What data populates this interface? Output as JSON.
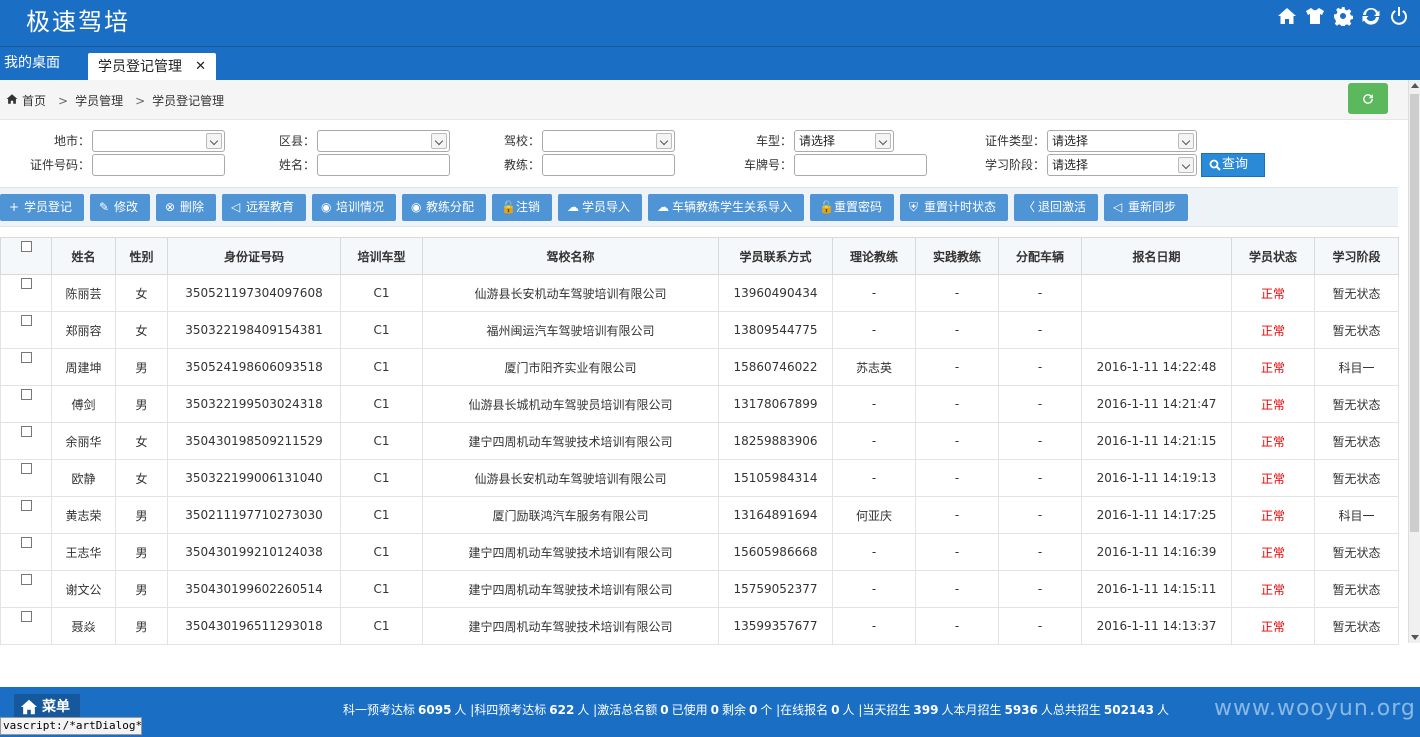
{
  "header": {
    "brand": "极速驾培",
    "icons": [
      "home-icon",
      "shirt-icon",
      "gear-icon",
      "refresh-icon",
      "power-icon"
    ]
  },
  "tabs": {
    "desk": "我的桌面",
    "active": "学员登记管理",
    "close": "✕"
  },
  "breadcrumb": {
    "home": "首页",
    "level1": "学员管理",
    "level2": "学员登记管理",
    "sep": ">"
  },
  "filters": {
    "city_label": "地市：",
    "district_label": "区县：",
    "school_label": "驾校：",
    "car_type_label": "车型：",
    "car_type_value": "请选择",
    "id_type_label": "证件类型：",
    "id_type_value": "请选择",
    "id_no_label": "证件号码：",
    "name_label": "姓名：",
    "coach_label": "教练：",
    "plate_label": "车牌号：",
    "stage_label": "学习阶段：",
    "stage_value": "请选择",
    "search_label": "查询"
  },
  "toolbar": [
    {
      "icon": "+",
      "label": "学员登记"
    },
    {
      "icon": "✎",
      "label": "修改"
    },
    {
      "icon": "⊗",
      "label": "删除"
    },
    {
      "icon": "◁",
      "label": "远程教育"
    },
    {
      "icon": "◉",
      "label": "培训情况"
    },
    {
      "icon": "◉",
      "label": "教练分配"
    },
    {
      "icon": "🔓",
      "label": "注销"
    },
    {
      "icon": "☁",
      "label": "学员导入"
    },
    {
      "icon": "☁",
      "label": "车辆教练学生关系导入"
    },
    {
      "icon": "🔓",
      "label": "重置密码"
    },
    {
      "icon": "⛨",
      "label": "重置计时状态"
    },
    {
      "icon": "〈",
      "label": "退回激活"
    },
    {
      "icon": "◁",
      "label": "重新同步"
    }
  ],
  "table": {
    "columns": [
      "姓名",
      "性别",
      "身份证号码",
      "培训车型",
      "驾校名称",
      "学员联系方式",
      "理论教练",
      "实践教练",
      "分配车辆",
      "报名日期",
      "学员状态",
      "学习阶段"
    ],
    "rows": [
      [
        "陈丽芸",
        "女",
        "350521197304097608",
        "C1",
        "仙游县长安机动车驾驶培训有限公司",
        "13960490434",
        "-",
        "-",
        "-",
        "",
        "正常",
        "暂无状态"
      ],
      [
        "郑丽容",
        "女",
        "350322198409154381",
        "C1",
        "福州闽运汽车驾驶培训有限公司",
        "13809544775",
        "-",
        "-",
        "-",
        "",
        "正常",
        "暂无状态"
      ],
      [
        "周建坤",
        "男",
        "350524198606093518",
        "C1",
        "厦门市阳齐实业有限公司",
        "15860746022",
        "苏志英",
        "-",
        "-",
        "2016-1-11 14:22:48",
        "正常",
        "科目一"
      ],
      [
        "傅剑",
        "男",
        "350322199503024318",
        "C1",
        "仙游县长城机动车驾驶员培训有限公司",
        "13178067899",
        "-",
        "-",
        "-",
        "2016-1-11 14:21:47",
        "正常",
        "暂无状态"
      ],
      [
        "余丽华",
        "女",
        "350430198509211529",
        "C1",
        "建宁四周机动车驾驶技术培训有限公司",
        "18259883906",
        "-",
        "-",
        "-",
        "2016-1-11 14:21:15",
        "正常",
        "暂无状态"
      ],
      [
        "欧静",
        "女",
        "350322199006131040",
        "C1",
        "仙游县长安机动车驾驶培训有限公司",
        "15105984314",
        "-",
        "-",
        "-",
        "2016-1-11 14:19:13",
        "正常",
        "暂无状态"
      ],
      [
        "黄志荣",
        "男",
        "350211197710273030",
        "C1",
        "厦门励联鸿汽车服务有限公司",
        "13164891694",
        "何亚庆",
        "-",
        "-",
        "2016-1-11 14:17:25",
        "正常",
        "科目一"
      ],
      [
        "王志华",
        "男",
        "350430199210124038",
        "C1",
        "建宁四周机动车驾驶技术培训有限公司",
        "15605986668",
        "-",
        "-",
        "-",
        "2016-1-11 14:16:39",
        "正常",
        "暂无状态"
      ],
      [
        "谢文公",
        "男",
        "350430199602260514",
        "C1",
        "建宁四周机动车驾驶技术培训有限公司",
        "15759052377",
        "-",
        "-",
        "-",
        "2016-1-11 14:15:11",
        "正常",
        "暂无状态"
      ],
      [
        "聂焱",
        "男",
        "350430196511293018",
        "C1",
        "建宁四周机动车驾驶技术培训有限公司",
        "13599357677",
        "-",
        "-",
        "-",
        "2016-1-11 14:13:37",
        "正常",
        "暂无状态"
      ]
    ]
  },
  "footer": {
    "menu": "菜单",
    "stats": [
      {
        "t": "科一预考达标"
      },
      {
        "v": "6095"
      },
      {
        "t": "人 |科四预考达标"
      },
      {
        "v": "622"
      },
      {
        "t": "人 |激活总名额"
      },
      {
        "v": "0"
      },
      {
        "t": "已使用"
      },
      {
        "v": "0"
      },
      {
        "t": "剩余"
      },
      {
        "v": "0"
      },
      {
        "t": "个 |在线报名"
      },
      {
        "v": "0"
      },
      {
        "t": "人 |当天招生"
      },
      {
        "v": "399"
      },
      {
        "t": "人本月招生"
      },
      {
        "v": "5936"
      },
      {
        "t": "人总共招生"
      },
      {
        "v": "502143"
      },
      {
        "t": "人"
      }
    ],
    "watermark": "www.wooyun.org",
    "status_url": "vascript:/*artDialog*/;"
  },
  "colors": {
    "brand_blue": "#1a6fc4",
    "button_blue": "#4f94d4",
    "status_red": "#e00",
    "refresh_green": "#5cb85c"
  }
}
